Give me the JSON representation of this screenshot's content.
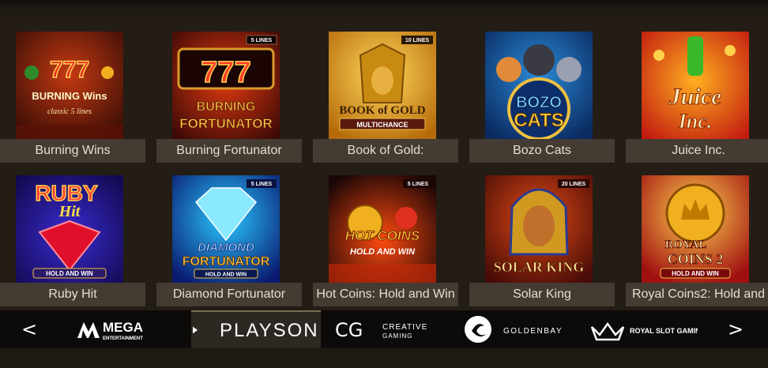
{
  "games_row1": [
    {
      "name": "Burning Wins",
      "art_title": "BURNING Wins",
      "art_sub": "classic 5 lines",
      "art_lines": ""
    },
    {
      "name": "Burning Fortunator",
      "art_title": "BURNING",
      "art_sub": "FORTUNATOR",
      "art_lines": "5 LINES"
    },
    {
      "name": "Book of Gold:",
      "art_title": "BOOK of GOLD",
      "art_sub": "MULTICHANCE",
      "art_lines": "10 LINES"
    },
    {
      "name": "Bozo Cats",
      "art_title": "BOZO",
      "art_sub": "CATS",
      "art_lines": ""
    },
    {
      "name": "Juice Inc.",
      "art_title": "Juice",
      "art_sub": "Inc.",
      "art_lines": ""
    }
  ],
  "games_row2": [
    {
      "name": "Ruby Hit",
      "art_title": "RUBY",
      "art_sub": "Hit",
      "art_badge": "HOLD AND WIN",
      "art_lines": ""
    },
    {
      "name": "Diamond Fortunator",
      "art_title": "DIAMOND",
      "art_sub": "FORTUNATOR",
      "art_badge": "HOLD AND WIN",
      "art_lines": "5 LINES"
    },
    {
      "name": "Hot Coins: Hold and Win",
      "art_title": "HOT COINS",
      "art_sub": "HOLD AND WIN",
      "art_badge": "",
      "art_lines": "5 LINES"
    },
    {
      "name": "Solar King",
      "art_title": "SOLAR KING",
      "art_sub": "",
      "art_badge": "",
      "art_lines": "20 LINES"
    },
    {
      "name": "Royal Coins2: Hold and",
      "art_title": "ROYAL",
      "art_sub": "COINS 2",
      "art_badge": "HOLD AND WIN",
      "art_lines": ""
    }
  ],
  "providers": {
    "prev": "<",
    "next": ">",
    "mega": {
      "line1": "MEGA",
      "line2": "ENTERTAINMENT"
    },
    "playson": "PLAYSON",
    "creative": {
      "mark": "CG",
      "line1": "CREATIVE",
      "line2": "GAMING"
    },
    "goldenbay": "GOLDENBAY",
    "royal": "ROYAL SLOT GAMING"
  }
}
